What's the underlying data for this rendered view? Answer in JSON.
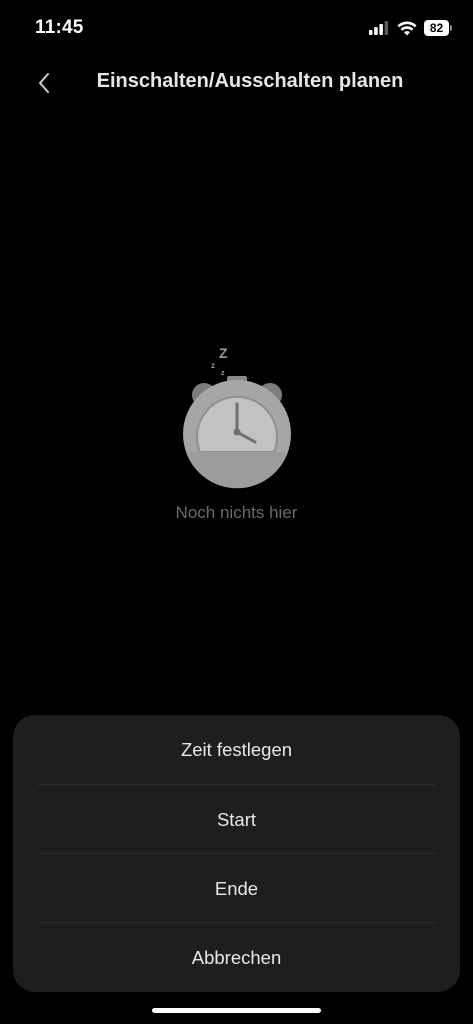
{
  "status_bar": {
    "time": "11:45",
    "battery_level": "82",
    "signal_icon": "cellular-signal-icon",
    "wifi_icon": "wifi-icon"
  },
  "header": {
    "title": "Einschalten/Ausschalten planen",
    "back_icon": "chevron-left-icon"
  },
  "empty_state": {
    "illustration": "sleeping-alarm-clock-icon",
    "message": "Noch nichts hier"
  },
  "action_sheet": {
    "items": [
      {
        "label": "Zeit festlegen"
      },
      {
        "label": "Start"
      },
      {
        "label": "Ende"
      },
      {
        "label": "Abbrechen"
      }
    ]
  },
  "colors": {
    "background": "#000000",
    "sheet_background": "#1e1e1e",
    "text_primary": "#e8e8e8",
    "text_muted": "#6a6a6a"
  }
}
